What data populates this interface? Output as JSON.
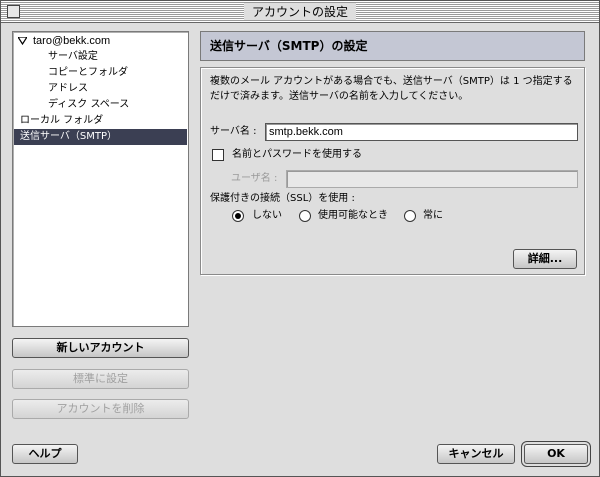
{
  "window": {
    "title": "アカウントの設定"
  },
  "tree": {
    "items": [
      {
        "label": "taro@bekk.com"
      },
      {
        "label": "サーバ設定"
      },
      {
        "label": "コピーとフォルダ"
      },
      {
        "label": "アドレス"
      },
      {
        "label": "ディスク スペース"
      },
      {
        "label": "ローカル フォルダ"
      },
      {
        "label": "送信サーバ（SMTP）"
      }
    ],
    "selected_index": 6
  },
  "left_buttons": {
    "new_account": "新しいアカウント",
    "set_default": "標準に設定",
    "delete_account": "アカウントを削除"
  },
  "panel": {
    "header": "送信サーバ（SMTP）の設定",
    "description": "複数のメール アカウントがある場合でも、送信サーバ（SMTP）は 1 つ指定するだけで済みます。送信サーバの名前を入力してください。",
    "server_name_label": "サーバ名 :",
    "server_name_value": "smtp.bekk.com",
    "use_auth_label": "名前とパスワードを使用する",
    "use_auth_checked": false,
    "username_label": "ユーザ名 :",
    "username_value": "",
    "ssl_label": "保護付きの接続（SSL）を使用 :",
    "ssl_options": [
      "しない",
      "使用可能なとき",
      "常に"
    ],
    "ssl_selected": 0,
    "advanced_button": "詳細..."
  },
  "bottom_buttons": {
    "help": "ヘルプ",
    "cancel": "キャンセル",
    "ok": "OK"
  }
}
